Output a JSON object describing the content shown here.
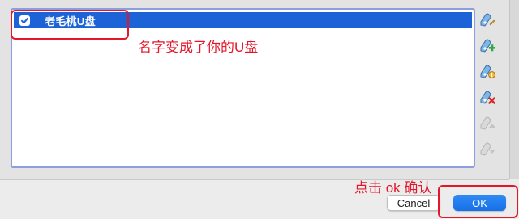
{
  "list": {
    "items": [
      {
        "label": "老毛桃U盘",
        "checked": true
      }
    ]
  },
  "annotations": {
    "rename_note": "名字变成了你的U盘",
    "ok_note": "点击 ok 确认",
    "color": "#e3162a"
  },
  "side_toolbar": {
    "icons": [
      {
        "name": "filter-edit-icon",
        "enabled": true
      },
      {
        "name": "filter-add-icon",
        "enabled": true
      },
      {
        "name": "filter-add-from-device-icon",
        "enabled": true
      },
      {
        "name": "filter-remove-icon",
        "enabled": true
      },
      {
        "name": "filter-move-up-icon",
        "enabled": false
      },
      {
        "name": "filter-move-down-icon",
        "enabled": false
      }
    ]
  },
  "buttons": {
    "cancel_label": "Cancel",
    "ok_label": "OK"
  },
  "colors": {
    "selection": "#1b63d6",
    "accent": "#1671e8"
  }
}
